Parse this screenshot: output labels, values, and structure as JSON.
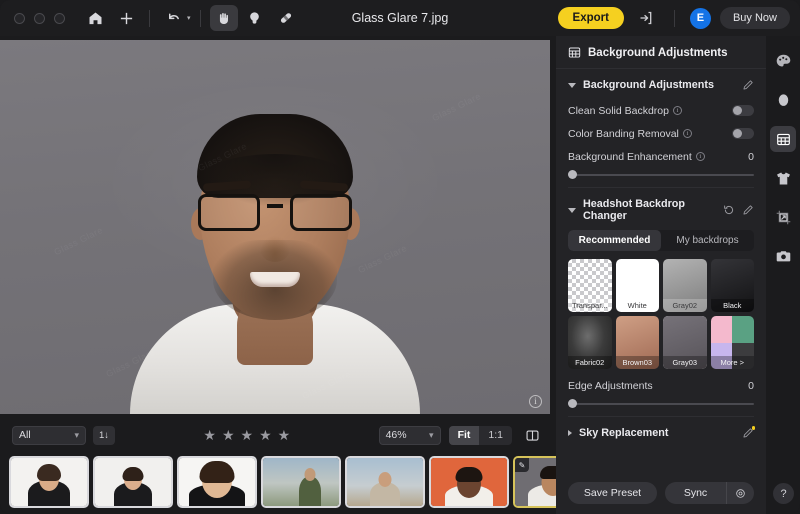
{
  "window": {
    "title": "Glass Glare 7.jpg",
    "traffic_lights": [
      "close",
      "minimize",
      "maximize"
    ]
  },
  "toolbar": {
    "home_icon": "home-icon",
    "add_icon": "plus-icon",
    "undo_icon": "undo-icon",
    "undo_caret": "▾",
    "hand_icon": "hand-tool-icon",
    "erase_icon": "erase-tool-icon",
    "heal_icon": "heal-brush-icon",
    "export_label": "Export",
    "share_icon": "share-export-icon",
    "avatar_initial": "E",
    "buy_label": "Buy Now",
    "accent_yellow": "#f5d020",
    "avatar_blue": "#1473e6"
  },
  "left_rail": {
    "items": [
      {
        "name": "ai-landscape-icon",
        "badge": true
      },
      {
        "name": "brightness-icon",
        "badge": false
      },
      {
        "name": "history-icon",
        "badge": false
      }
    ]
  },
  "canvas": {
    "watermarks": [
      "Glass Glare",
      "Glass Glare",
      "Glass Glare",
      "Glass Glare",
      "Glass Glare",
      "Glass Glare"
    ],
    "info_icon": "info-icon",
    "background_color": "#767479"
  },
  "bottom_bar": {
    "filter_value": "All",
    "filter_caret": "⌄",
    "sort_icon": "1↓",
    "stars": [
      "★",
      "★",
      "★",
      "★",
      "★"
    ],
    "star_color": "#9a9aa0",
    "zoom_value": "46%",
    "zoom_caret": "⌄",
    "fit_label": "Fit",
    "one_to_one_label": "1:1",
    "active_view": "Fit",
    "split_icon": "split-view-icon"
  },
  "filmstrip": {
    "items": [
      {
        "name": "thumb-1",
        "selected": false,
        "edited": false,
        "bg": "#f3f2f0",
        "skin": "#d9ab87",
        "hair": "#3a2a20",
        "body": "#1b1b1d",
        "scene": "portrait"
      },
      {
        "name": "thumb-2",
        "selected": false,
        "edited": false,
        "bg": "#f1f0ee",
        "skin": "#dcae8c",
        "hair": "#2e2119",
        "body": "#1b1b1d",
        "scene": "portrait"
      },
      {
        "name": "thumb-3",
        "selected": false,
        "edited": false,
        "bg": "#f6f5f3",
        "skin": "#e0b894",
        "hair": "#332217",
        "body": "#141416",
        "scene": "portrait"
      },
      {
        "name": "thumb-4",
        "selected": false,
        "edited": false,
        "bg": "#9fb6c8",
        "skin": "#c19a78",
        "hair": "#2d2017",
        "body": "#51603f",
        "scene": "outdoor"
      },
      {
        "name": "thumb-5",
        "selected": false,
        "edited": false,
        "bg": "#a8bed0",
        "skin": "#c99e7c",
        "hair": "#3b2b1f",
        "body": "#c3b7a4",
        "scene": "outdoor"
      },
      {
        "name": "thumb-6",
        "selected": false,
        "edited": false,
        "bg": "#e0663c",
        "skin": "#6b4430",
        "hair": "#1d1511",
        "body": "#f2efea",
        "scene": "portrait"
      },
      {
        "name": "thumb-7",
        "selected": true,
        "edited": true,
        "bg": "#6f6d72",
        "skin": "#b9865f",
        "hair": "#191310",
        "body": "#eceae6",
        "scene": "portrait"
      },
      {
        "name": "thumb-8",
        "selected": false,
        "edited": false,
        "bg": "#cfc6b6",
        "skin": "#e3bc9b",
        "hair": "#9a7c4e",
        "body": "#5d86b0",
        "scene": "family"
      },
      {
        "name": "thumb-9",
        "selected": false,
        "edited": false,
        "bg": "#c8cdd4",
        "skin": "#e0b795",
        "hair": "#4a3426",
        "body": "#4f7fae",
        "scene": "family"
      }
    ],
    "edit_badge_icon": "edit-pencil-icon"
  },
  "right_panel": {
    "header": {
      "icon": "background-panel-icon",
      "title": "Background Adjustments"
    },
    "background_adjustments": {
      "title": "Background Adjustments",
      "expanded": true,
      "edit_icon": "pencil-icon",
      "rows": [
        {
          "label": "Clean Solid Backdrop",
          "info": true,
          "type": "toggle",
          "value": "off"
        },
        {
          "label": "Color Banding Removal",
          "info": true,
          "type": "toggle",
          "value": "off"
        },
        {
          "label": "Background Enhancement",
          "info": true,
          "type": "slider",
          "value": "0",
          "position": 0
        }
      ]
    },
    "headshot_backdrop_changer": {
      "title": "Headshot Backdrop Changer",
      "expanded": true,
      "reset_icon": "reset-icon",
      "edit_icon": "pencil-icon",
      "tabs": [
        {
          "label": "Recommended",
          "active": true
        },
        {
          "label": "My backdrops",
          "active": false
        }
      ],
      "swatches": [
        {
          "label": "Transpar...",
          "kind": "checker",
          "selected": false,
          "light": true
        },
        {
          "label": "White",
          "kind": "solid",
          "color": "#ffffff",
          "selected": false,
          "light": true
        },
        {
          "label": "Gray02",
          "kind": "gradient",
          "color": "#a9a9a9",
          "color2": "#8e8e8e",
          "selected": false,
          "light": true
        },
        {
          "label": "Black",
          "kind": "gradient",
          "color": "#2e2e2e",
          "color2": "#141414",
          "selected": false,
          "light": false
        },
        {
          "label": "Fabric02",
          "kind": "fabric",
          "color": "#3b3b3b",
          "selected": false,
          "light": false
        },
        {
          "label": "Brown03",
          "kind": "gradient",
          "color": "#c89a80",
          "color2": "#a9705a",
          "selected": false,
          "light": false
        },
        {
          "label": "Gray03",
          "kind": "gradient",
          "color": "#6e6a70",
          "color2": "#5a565c",
          "selected": true,
          "light": false
        },
        {
          "label": "More >",
          "kind": "quad",
          "quad": [
            "#f4b9cd",
            "#5aa183",
            "#c7b6ee",
            "#3c3c3e"
          ],
          "selected": false,
          "light": false
        }
      ],
      "edge_adjustments": {
        "label": "Edge Adjustments",
        "value": "0",
        "position": 0
      }
    },
    "sky_replacement": {
      "title": "Sky Replacement",
      "expanded": false,
      "edit_icon": "pencil-icon",
      "badge": true
    },
    "footer": {
      "save_preset_label": "Save Preset",
      "sync_label": "Sync",
      "sync_settings_icon": "gear-icon"
    }
  },
  "right_rail": {
    "items": [
      {
        "name": "palette-icon",
        "active": false
      },
      {
        "name": "portrait-face-icon",
        "active": false
      },
      {
        "name": "background-icon",
        "active": true
      },
      {
        "name": "clothes-icon",
        "active": false
      },
      {
        "name": "crop-transform-icon",
        "active": false
      },
      {
        "name": "camera-icon",
        "active": false
      }
    ],
    "help_label": "?"
  }
}
